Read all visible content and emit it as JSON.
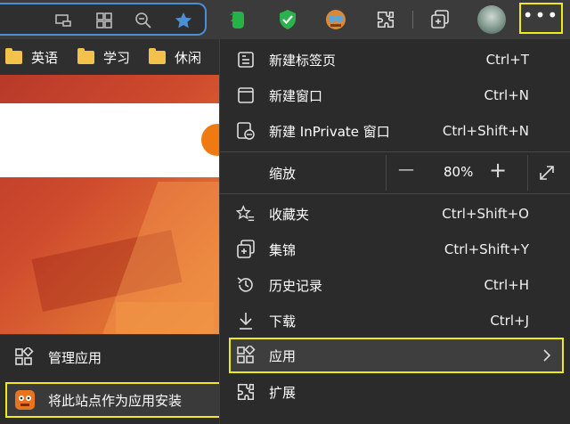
{
  "bookmarks": [
    {
      "label": "英语"
    },
    {
      "label": "学习"
    },
    {
      "label": "休闲"
    }
  ],
  "menu": {
    "new_tab": {
      "label": "新建标签页",
      "shortcut": "Ctrl+T",
      "icon": "new-tab-icon"
    },
    "new_window": {
      "label": "新建窗口",
      "shortcut": "Ctrl+N",
      "icon": "new-window-icon"
    },
    "new_inprivate": {
      "label": "新建 InPrivate 窗口",
      "shortcut": "Ctrl+Shift+N",
      "icon": "inprivate-icon"
    },
    "zoom": {
      "label": "缩放",
      "value": "80%",
      "minus": "—",
      "plus": "+"
    },
    "favorites": {
      "label": "收藏夹",
      "shortcut": "Ctrl+Shift+O",
      "icon": "favorites-icon"
    },
    "collections": {
      "label": "集锦",
      "shortcut": "Ctrl+Shift+Y",
      "icon": "collections-icon"
    },
    "history": {
      "label": "历史记录",
      "shortcut": "Ctrl+H",
      "icon": "history-icon"
    },
    "downloads": {
      "label": "下载",
      "shortcut": "Ctrl+J",
      "icon": "download-icon"
    },
    "apps": {
      "label": "应用",
      "icon": "apps-icon"
    },
    "extensions": {
      "label": "扩展",
      "icon": "extensions-icon"
    }
  },
  "submenu": {
    "manage_apps": {
      "label": "管理应用"
    },
    "install_site": {
      "label": "将此站点作为应用安装"
    }
  },
  "colors": {
    "highlight": "#f1ea1b",
    "menu_bg": "#2b2b2b",
    "star": "#4b8fd6"
  }
}
